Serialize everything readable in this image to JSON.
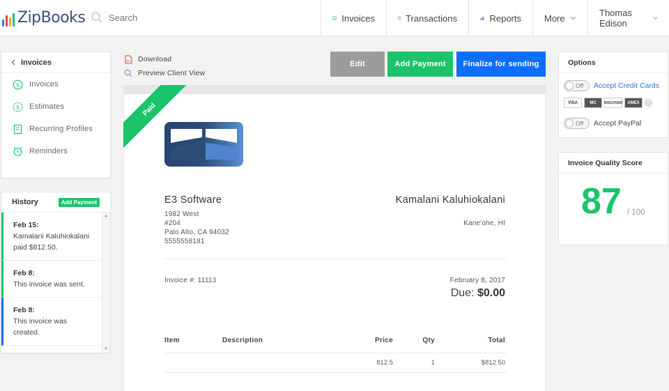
{
  "app": {
    "name": "ZipBooks"
  },
  "search": {
    "placeholder": "Search"
  },
  "nav": {
    "invoices": "Invoices",
    "transactions": "Transactions",
    "reports": "Reports",
    "more": "More",
    "user": "Thomas Edison"
  },
  "sidebar": {
    "back_label": "Invoices",
    "items": [
      {
        "label": "Invoices",
        "icon": "dollar-circle-icon"
      },
      {
        "label": "Estimates",
        "icon": "dollar-circle-icon"
      },
      {
        "label": "Recurring Profiles",
        "icon": "document-icon"
      },
      {
        "label": "Reminders",
        "icon": "alarm-icon"
      }
    ]
  },
  "history": {
    "title": "History",
    "add_payment": "Add Payment",
    "entries": [
      {
        "date": "Feb 15:",
        "text": "Kamalani Kaluhiokalani paid $812.50."
      },
      {
        "date": "Feb 8:",
        "text": "This invoice was sent."
      },
      {
        "date": "Feb 8:",
        "text": "This invoice was created."
      }
    ]
  },
  "actions": {
    "download": "Download",
    "preview": "Preview Client View",
    "edit": "Edit",
    "add_payment": "Add Payment",
    "finalize": "Finalize for sending"
  },
  "invoice": {
    "status": "Paid",
    "from": {
      "name": "E3 Software",
      "address1": "1982 West",
      "address2": "#204",
      "city": "Palo Alto, CA 94032",
      "phone": "5555558181"
    },
    "to": {
      "name": "Kamalani Kaluhiokalani",
      "city": "Kane'ohe, HI"
    },
    "number_label": "Invoice #: 11113",
    "date": "February 8, 2017",
    "due_label": "Due:",
    "due_amount": "$0.00",
    "columns": {
      "item": "Item",
      "description": "Description",
      "price": "Price",
      "qty": "Qty",
      "total": "Total"
    },
    "lines": [
      {
        "item": "",
        "description": "",
        "price": "812.5",
        "qty": "1",
        "total": "$812.50"
      }
    ]
  },
  "options": {
    "title": "Options",
    "toggle_off": "Off",
    "credit_cards": "Accept Credit Cards",
    "paypal": "Accept PayPal",
    "card_brands": [
      "VISA",
      "MC",
      "DISCOVER",
      "AMEX"
    ]
  },
  "quality": {
    "title": "Invoice Quality Score",
    "score": "87",
    "max": "/ 100"
  },
  "colors": {
    "green": "#1bc46b",
    "blue": "#0d6efd",
    "gray_button": "#9c9c9c",
    "logo_navy": "#2c4d78",
    "logo_blue": "#5b8fd6"
  }
}
